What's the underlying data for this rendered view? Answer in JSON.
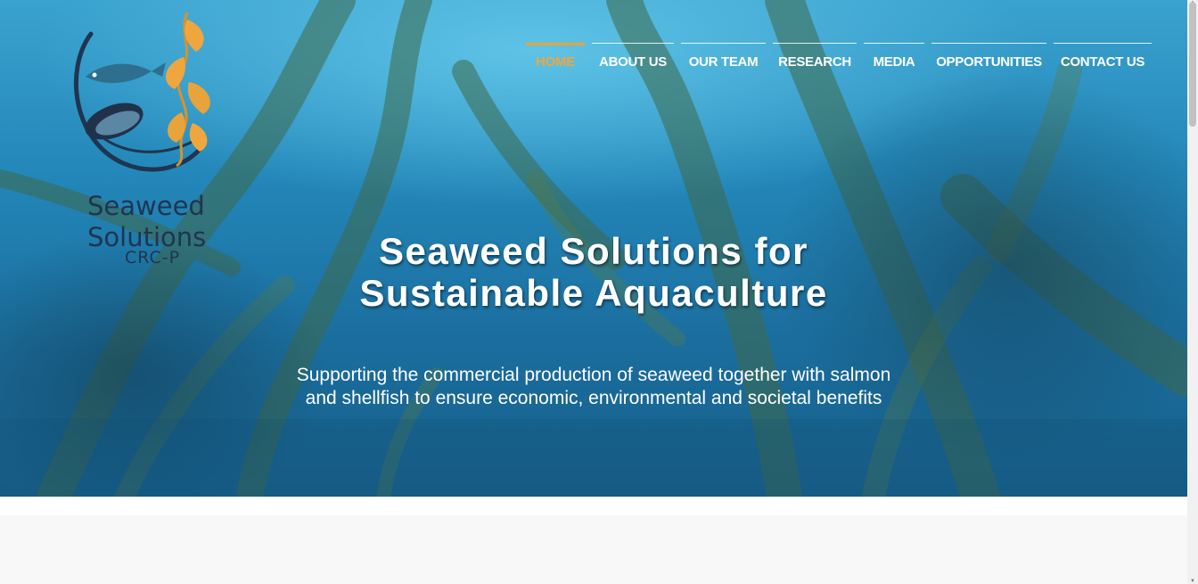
{
  "brand": {
    "name": "Seaweed Solutions",
    "sub": "CRC-P",
    "colors": {
      "navy": "#1f3550",
      "orange": "#e8a33a",
      "ocean": "#1e7fb1"
    }
  },
  "nav": {
    "items": [
      {
        "label": "HOME",
        "active": true
      },
      {
        "label": "ABOUT US"
      },
      {
        "label": "OUR TEAM"
      },
      {
        "label": "RESEARCH"
      },
      {
        "label": "MEDIA"
      },
      {
        "label": "OPPORTUNITIES"
      },
      {
        "label": "CONTACT US"
      }
    ]
  },
  "hero": {
    "title_line1": "Seaweed Solutions for",
    "title_line2": "Sustainable Aquaculture",
    "subtitle_line1": "Supporting the commercial production of seaweed together with salmon",
    "subtitle_line2": "and shellfish to ensure economic, environmental and societal benefits"
  },
  "icons": {
    "logo": "fish-mussel-kelp-logo-icon"
  }
}
